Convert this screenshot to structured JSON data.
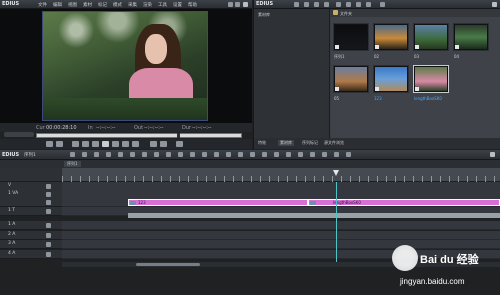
{
  "player": {
    "app_label": "EDIUS",
    "menu": [
      "文件",
      "编辑",
      "视图",
      "素材",
      "标记",
      "模式",
      "采集",
      "渲染",
      "工具",
      "设置",
      "帮助"
    ],
    "cur_label": "Cur",
    "cur_value": "00:00:28:10",
    "in_label": "In",
    "in_value": "--:--:--:--",
    "out_label": "Out",
    "out_value": "--:--:--:--",
    "dur_label": "Dur",
    "dur_value": "--:--:--:--"
  },
  "bin": {
    "app_label": "EDIUS",
    "title": "素材库",
    "folder_label": "根文件夹",
    "root_label": "文件夹",
    "tabs": [
      "特效",
      "素材库",
      "序列标记",
      "源文件浏览"
    ],
    "clips": [
      {
        "caption": "序列1",
        "selected": false,
        "caption_color": "normal"
      },
      {
        "caption": "02",
        "selected": false,
        "caption_color": "normal"
      },
      {
        "caption": "03",
        "selected": false,
        "caption_color": "normal"
      },
      {
        "caption": "04",
        "selected": false,
        "caption_color": "normal"
      },
      {
        "caption": "05",
        "selected": false,
        "caption_color": "normal"
      },
      {
        "caption": "123",
        "selected": false,
        "caption_color": "blue"
      },
      {
        "caption": "lengthBoxSK0",
        "selected": true,
        "caption_color": "blue"
      }
    ]
  },
  "timeline": {
    "app_label": "EDIUS",
    "sequence_label": "序列1",
    "tab_label": "序列1",
    "tracks": [
      "V",
      "1 VA",
      "",
      "1 T",
      "1 A",
      "2 A",
      "3 A",
      "4 A"
    ],
    "clip1_label": "123",
    "clip2_label": "lengthBoxSK0",
    "clip_color": "#d86fd6"
  },
  "watermark": {
    "brand": "Bai du 经验",
    "url": "jingyan.baidu.com"
  }
}
